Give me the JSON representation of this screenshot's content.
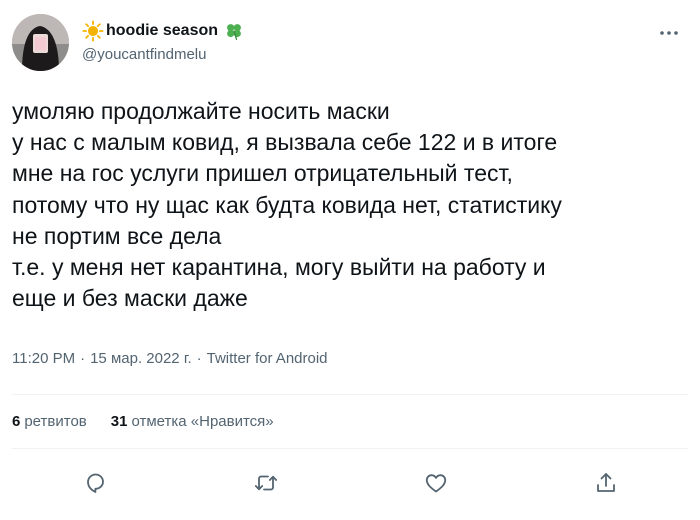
{
  "user": {
    "display_name": "hoodie season",
    "handle": "@youcantfindmelu",
    "name_icons": [
      "sun-icon",
      "four-leaf-clover-icon"
    ]
  },
  "tweet": {
    "lines": [
      "умоляю продолжайте носить маски",
      "у нас с малым ковид, я вызвала себе 122 и в итоге",
      "мне на гос услуги пришел отрицательный тест,",
      "потому что ну щас как будта ковида нет, статистику",
      "не портим все дела",
      "т.е. у меня нет карантина, могу выйти на работу и",
      "еще и без маски даже"
    ]
  },
  "meta": {
    "time": "11:20 PM",
    "separator": "·",
    "date": "15 мар. 2022 г.",
    "source": "Twitter for Android"
  },
  "stats": {
    "retweets_count": "6",
    "retweets_label": "ретвитов",
    "likes_count": "31",
    "likes_label": "отметка «Нравится»"
  },
  "actions": [
    "reply-icon",
    "retweet-icon",
    "like-icon",
    "share-icon"
  ],
  "colors": {
    "text": "#0f1419",
    "secondary": "#536471",
    "divider": "#eff3f4",
    "sun": "#f5b301",
    "clover": "#4caf50"
  }
}
